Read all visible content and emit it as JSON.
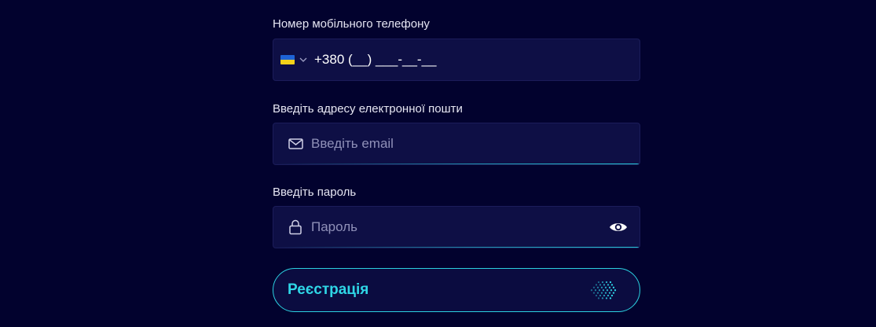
{
  "phone": {
    "label": "Номер мобільного телефону",
    "country_code": "+380",
    "mask": "+380 (__) ___-__-__",
    "flag_colors": {
      "top": "#1e63d6",
      "bottom": "#f4d21a"
    },
    "flag_icon": "ukraine-flag-icon",
    "dropdown_icon": "chevron-down-icon"
  },
  "email": {
    "label": "Введіть адресу електронної пошти",
    "placeholder": "Введіть email",
    "icon": "mail-icon"
  },
  "password": {
    "label": "Введіть пароль",
    "placeholder": "Пароль",
    "icon": "lock-icon",
    "toggle_icon": "eye-icon"
  },
  "register_button": {
    "label": "Реєстрація",
    "accent": "#2fd6e6",
    "icon": "dotted-arrow-icon"
  },
  "colors": {
    "background": "#02022e",
    "field": "#0e0f45",
    "accent": "#2bd0e0"
  }
}
